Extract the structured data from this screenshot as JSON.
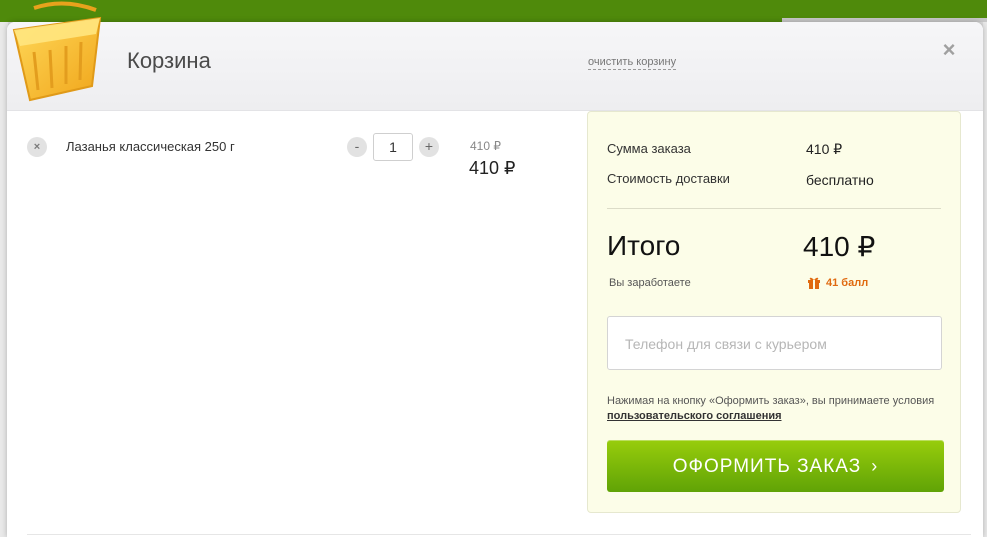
{
  "modal": {
    "title": "Корзина",
    "clear_label": "очистить корзину",
    "close_glyph": "×"
  },
  "cart": {
    "items": [
      {
        "remove_glyph": "×",
        "name": "Лазанья классическая 250 г",
        "qty_minus": "-",
        "quantity": "1",
        "qty_plus": "+",
        "old_price": "410 ₽",
        "price": "410 ₽"
      }
    ]
  },
  "summary": {
    "order_sum_label": "Сумма заказа",
    "order_sum_value": "410 ₽",
    "delivery_label": "Стоимость доставки",
    "delivery_value": "бесплатно",
    "total_label": "Итого",
    "total_value": "410 ₽",
    "earn_label": "Вы заработаете",
    "bonus_text": "41 балл",
    "phone_placeholder": "Телефон для связи с курьером",
    "terms_text": "Нажимая на кнопку «Оформить заказ», вы принимаете условия ",
    "terms_link": "пользовательского соглашения",
    "checkout_label": "ОФОРМИТЬ ЗАКАЗ",
    "checkout_chevron": "›"
  },
  "colors": {
    "brand_green": "#4f8a0b",
    "button_green_top": "#98cd0c",
    "button_green_bottom": "#60a306",
    "summary_bg": "#fcfde8",
    "bonus_orange": "#e06a10"
  }
}
